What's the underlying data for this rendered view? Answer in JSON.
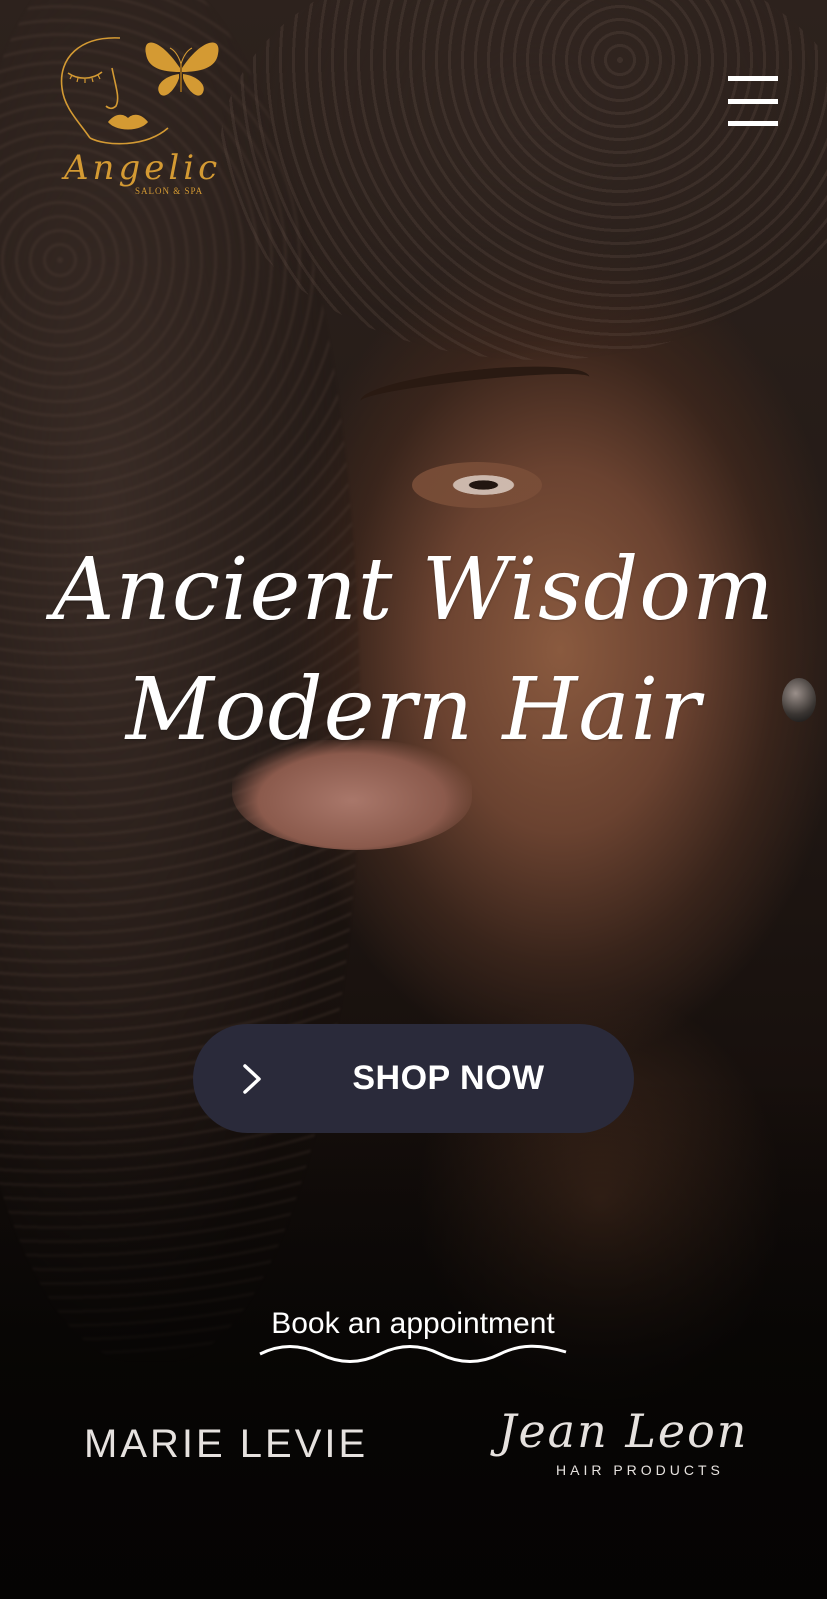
{
  "header": {
    "logo": {
      "name": "Angelic",
      "subtitle": "SALON & SPA",
      "icon": "butterfly-face-logo"
    },
    "menu_icon": "hamburger-menu-icon"
  },
  "hero": {
    "headline_line1": "Ancient Wisdom",
    "headline_line2": "Modern Hair",
    "cta": {
      "label": "SHOP NOW",
      "icon": "chevron-right-icon"
    },
    "book_link": "Book an appointment"
  },
  "brands": {
    "items": [
      {
        "name": "MARIE LEVIE"
      },
      {
        "name": "Jean Leon",
        "subtitle": "HAIR PRODUCTS"
      }
    ]
  },
  "colors": {
    "accent_gold": "#d49a33",
    "button_bg": "#2a2a3a",
    "text_white": "#ffffff"
  }
}
